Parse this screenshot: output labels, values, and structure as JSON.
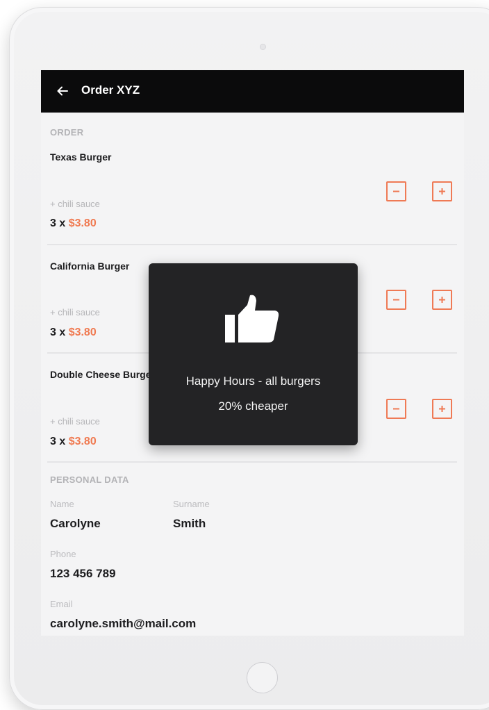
{
  "header": {
    "title": "Order XYZ",
    "back_icon": "arrow-left-icon"
  },
  "order": {
    "section_label": "ORDER",
    "items": [
      {
        "name": "Texas Burger",
        "extra": "+ chili sauce",
        "quantity": "3 x ",
        "price": "$3.80"
      },
      {
        "name": "California Burger",
        "extra": "+ chili sauce",
        "quantity": "3 x ",
        "price": "$3.80"
      },
      {
        "name": "Double Cheese Burger",
        "extra": "+ chili sauce",
        "quantity": "3 x ",
        "price": "$3.80"
      }
    ],
    "stepper_icons": {
      "decrease": "minus-icon",
      "increase": "plus-icon"
    }
  },
  "personal": {
    "section_label": "PERSONAL DATA",
    "name_label": "Name",
    "name_value": "Carolyne",
    "surname_label": "Surname",
    "surname_value": "Smith",
    "phone_label": "Phone",
    "phone_value": "123 456 789",
    "email_label": "Email",
    "email_value": "carolyne.smith@mail.com"
  },
  "toast": {
    "icon": "thumbs-up-icon",
    "line1": "Happy Hours - all burgers",
    "line2": "20% cheaper"
  },
  "colors": {
    "accent": "#ef7a55",
    "appbar": "#0b0b0c",
    "toast_bg": "#232325"
  }
}
